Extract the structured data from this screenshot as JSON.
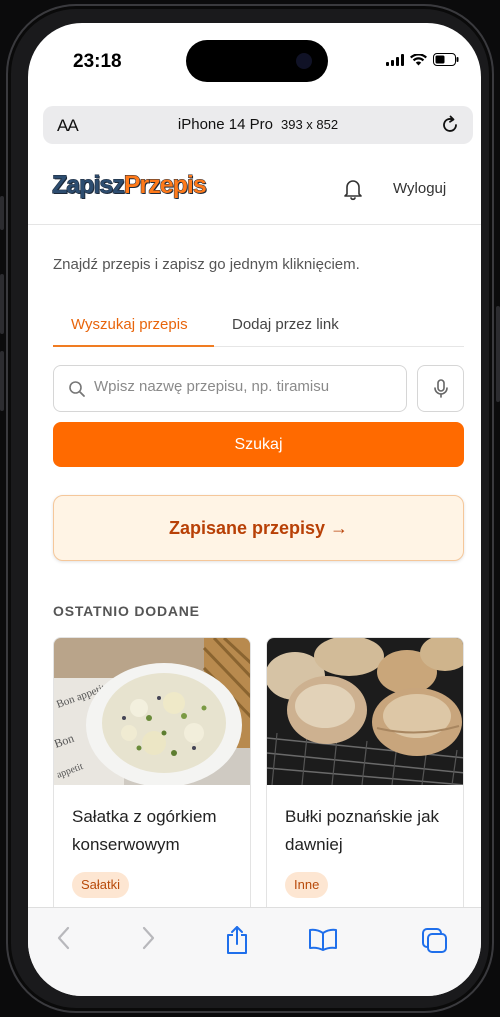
{
  "status_bar": {
    "time": "23:18"
  },
  "browser": {
    "text_size_label": "AA",
    "url_title": "iPhone 14 Pro",
    "url_dims": "393 x 852"
  },
  "header": {
    "logo_part1": "Zapisz",
    "logo_part2": "Przepis",
    "logout_label": "Wyloguj"
  },
  "intro_text": "Znajdź przepis i zapisz go jednym kliknięciem.",
  "tabs": [
    {
      "label": "Wyszukaj przepis",
      "active": true
    },
    {
      "label": "Dodaj przez link",
      "active": false
    }
  ],
  "search": {
    "placeholder": "Wpisz nazwę przepisu, np. tiramisu",
    "value": "",
    "button_label": "Szukaj"
  },
  "saved_button_label": "Zapisane przepisy →",
  "recent": {
    "title": "OSTATNIO DODANE",
    "items": [
      {
        "title": "Sałatka z ogórkiem konserwowym",
        "category": "Sałatki"
      },
      {
        "title": "Bułki poznańskie jak dawniej",
        "category": "Inne"
      }
    ]
  },
  "colors": {
    "accent": "#ff6a00",
    "logo_dark": "#2d4d70",
    "logo_orange": "#ff7a1a",
    "saved_bg": "#fff4e5",
    "badge_bg": "#fde6d2"
  },
  "icons": {
    "status": [
      "signal-icon",
      "wifi-icon",
      "battery-icon"
    ],
    "toolbar": [
      "back-icon",
      "forward-icon",
      "share-icon",
      "bookmarks-icon",
      "tabs-icon"
    ]
  }
}
